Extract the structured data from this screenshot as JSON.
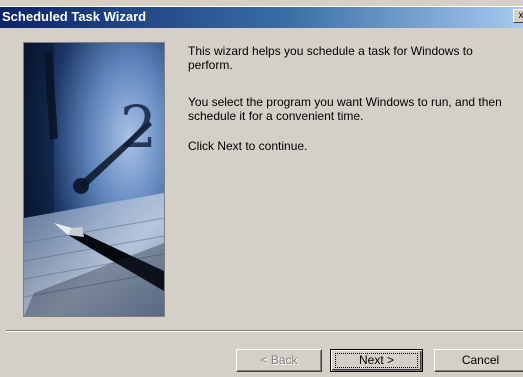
{
  "window": {
    "title": "Scheduled Task Wizard",
    "close_glyph": "x"
  },
  "content": {
    "paragraph1": "This wizard helps you schedule a task for Windows to perform.",
    "paragraph2": "You select the program you want Windows to run, and then schedule it for a convenient time.",
    "paragraph3": "Click Next to continue."
  },
  "buttons": {
    "back_label": "< Back",
    "next_label": "Next >",
    "cancel_label": "Cancel"
  },
  "colors": {
    "titlebar_start": "#0a246a",
    "titlebar_end": "#a6caf0",
    "face": "#d4d0c8",
    "disabled_text": "#808080"
  }
}
